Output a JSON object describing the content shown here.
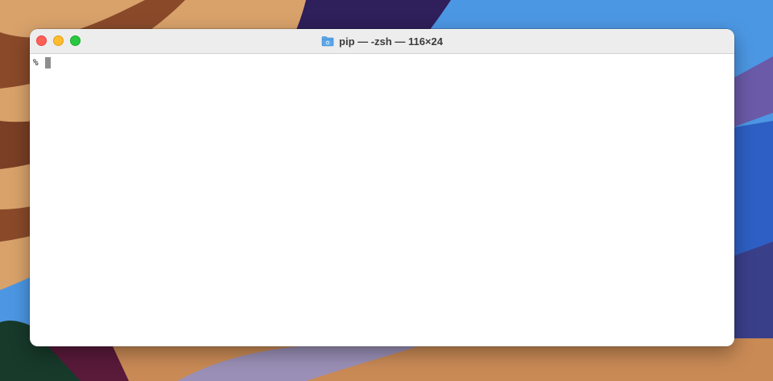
{
  "window": {
    "title": "pip — -zsh — 116×24",
    "title_icon": "folder-icon",
    "controls": [
      "close",
      "minimize",
      "zoom"
    ]
  },
  "terminal": {
    "lines": [
      {
        "prompt": "%",
        "input": ""
      }
    ],
    "cursor_style": "block"
  },
  "colors": {
    "close": "#ff5f57",
    "minimize": "#febc2e",
    "zoom": "#28c840",
    "titlebar": "#ededed",
    "terminal_bg": "#ffffff",
    "cursor": "#8e8e8e",
    "folder_icon": "#5aa6e8"
  }
}
